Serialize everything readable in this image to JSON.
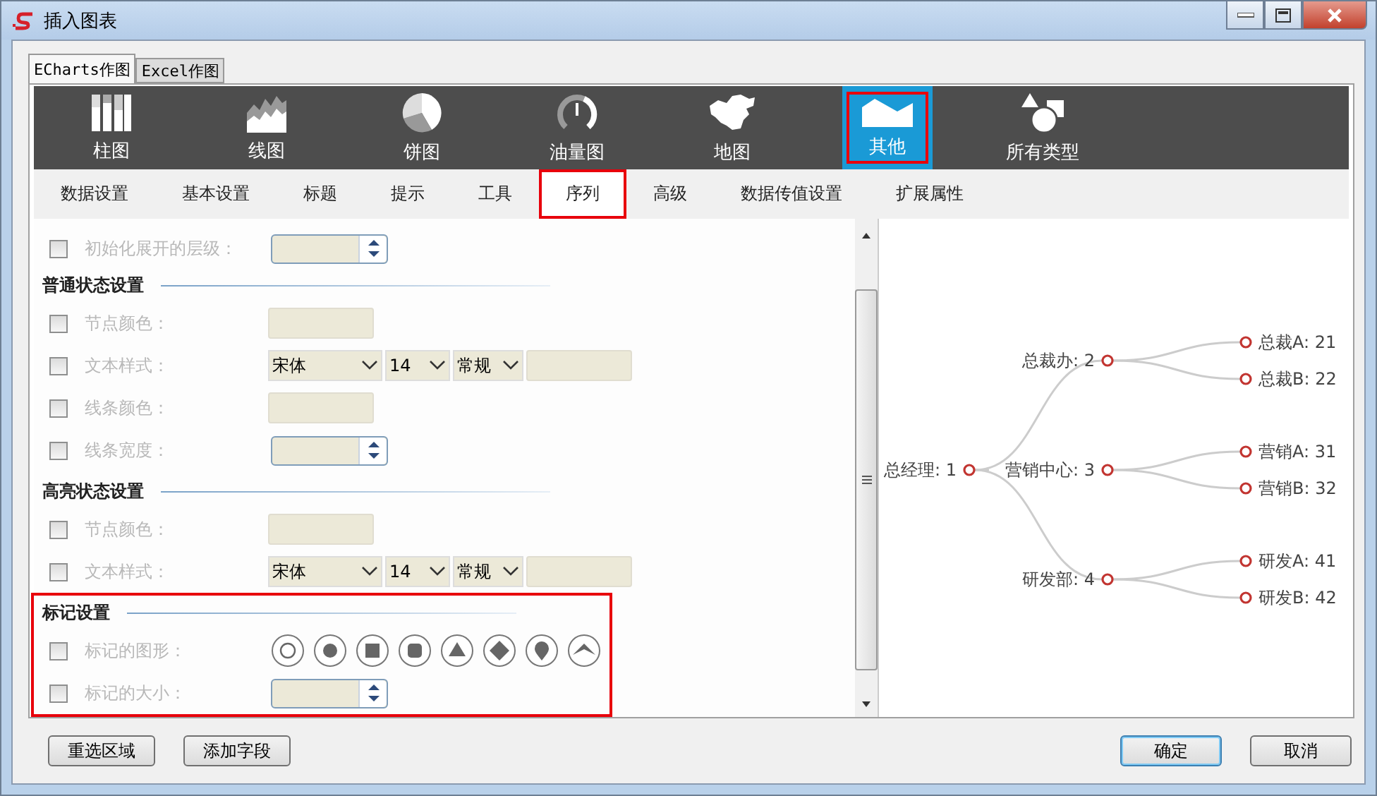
{
  "window": {
    "title": "插入图表"
  },
  "mode_tabs": [
    {
      "label": "ECharts作图",
      "selected": true
    },
    {
      "label": "Excel作图",
      "selected": false
    }
  ],
  "chart_types": [
    {
      "kind": "bar",
      "label": "柱图",
      "selected": false
    },
    {
      "kind": "line",
      "label": "线图",
      "selected": false
    },
    {
      "kind": "pie",
      "label": "饼图",
      "selected": false
    },
    {
      "kind": "gauge",
      "label": "油量图",
      "selected": false
    },
    {
      "kind": "map",
      "label": "地图",
      "selected": false
    },
    {
      "kind": "other",
      "label": "其他",
      "selected": true
    },
    {
      "kind": "all",
      "label": "所有类型",
      "selected": false
    }
  ],
  "settings_tabs": [
    {
      "label": "数据设置",
      "selected": false
    },
    {
      "label": "基本设置",
      "selected": false
    },
    {
      "label": "标题",
      "selected": false
    },
    {
      "label": "提示",
      "selected": false
    },
    {
      "label": "工具",
      "selected": false
    },
    {
      "label": "序列",
      "selected": true
    },
    {
      "label": "高级",
      "selected": false
    },
    {
      "label": "数据传值设置",
      "selected": false
    },
    {
      "label": "扩展属性",
      "selected": false
    }
  ],
  "pre_rows": [
    {
      "kind": "spinner",
      "label": "初始化展开的层级：",
      "checked": false
    }
  ],
  "sections": [
    {
      "title": "普通状态设置",
      "highlighted": false,
      "rows": [
        {
          "kind": "color",
          "label": "节点颜色：",
          "checked": false
        },
        {
          "kind": "text_style",
          "label": "文本样式：",
          "checked": false,
          "font": "宋体",
          "size": "14",
          "weight": "常规"
        },
        {
          "kind": "color",
          "label": "线条颜色：",
          "checked": false
        },
        {
          "kind": "spinner",
          "label": "线条宽度：",
          "checked": false
        }
      ]
    },
    {
      "title": "高亮状态设置",
      "highlighted": false,
      "rows": [
        {
          "kind": "color",
          "label": "节点颜色：",
          "checked": false
        },
        {
          "kind": "text_style",
          "label": "文本样式：",
          "checked": false,
          "font": "宋体",
          "size": "14",
          "weight": "常规"
        }
      ]
    },
    {
      "title": "标记设置",
      "highlighted": true,
      "rows": [
        {
          "kind": "shapes",
          "label": "标记的图形：",
          "checked": false,
          "shapes": [
            {
              "kind": "empty_circle"
            },
            {
              "kind": "circle"
            },
            {
              "kind": "square"
            },
            {
              "kind": "rounded_square"
            },
            {
              "kind": "triangle"
            },
            {
              "kind": "diamond"
            },
            {
              "kind": "pin"
            },
            {
              "kind": "arrow"
            }
          ]
        },
        {
          "kind": "spinner",
          "label": "标记的大小：",
          "checked": false
        }
      ]
    }
  ],
  "preview": {
    "tree": {
      "label": "总经理: 1",
      "children": [
        {
          "label": "总裁办: 2",
          "children": [
            {
              "label": "总裁A: 21"
            },
            {
              "label": "总裁B: 22"
            }
          ]
        },
        {
          "label": "营销中心: 3",
          "children": [
            {
              "label": "营销A: 31"
            },
            {
              "label": "营销B: 32"
            }
          ]
        },
        {
          "label": "研发部: 4",
          "children": [
            {
              "label": "研发A: 41"
            },
            {
              "label": "研发B: 42"
            }
          ]
        }
      ]
    }
  },
  "buttons_left": [
    "重选区域",
    "添加字段"
  ],
  "buttons_right": [
    {
      "label": "确定",
      "default": true
    },
    {
      "label": "取消",
      "default": false
    }
  ]
}
